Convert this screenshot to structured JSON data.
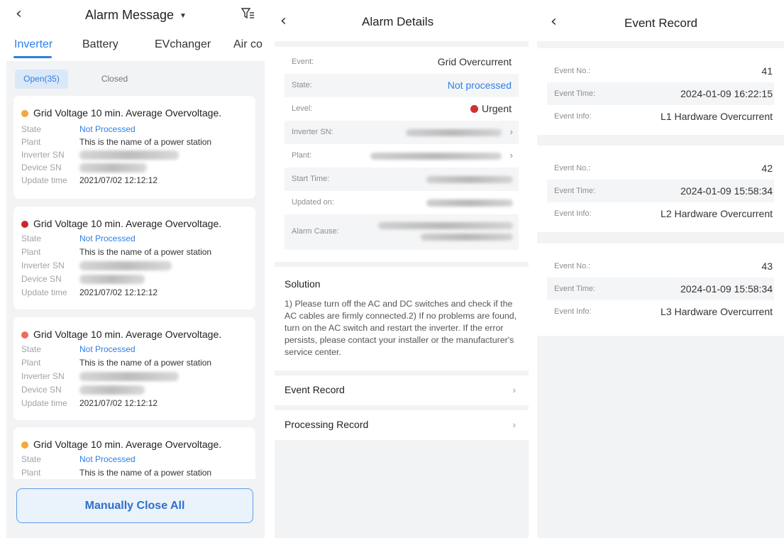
{
  "screen1": {
    "title": "Alarm Message",
    "tabs": [
      "Inverter",
      "Battery",
      "EVchanger",
      "Air co"
    ],
    "chip_open": "Open(35)",
    "chip_closed": "Closed",
    "labels": {
      "state": "State",
      "plant": "Plant",
      "inverter_sn": "Inverter SN",
      "device_sn": "Device SN",
      "update_time": "Update time"
    },
    "cards": [
      {
        "title": "Grid Voltage 10 min. Average Overvoltage.",
        "dot_color": "#f0a93b",
        "state": "Not Processed",
        "plant": "This is the name of a power station",
        "update_time": "2021/07/02 12:12:12"
      },
      {
        "title": "Grid Voltage 10 min. Average Overvoltage.",
        "dot_color": "#c8262b",
        "state": "Not Processed",
        "plant": "This is the name of a power station",
        "update_time": "2021/07/02 12:12:12"
      },
      {
        "title": "Grid Voltage 10 min. Average Overvoltage.",
        "dot_color": "#ee6a5e",
        "state": "Not Processed",
        "plant": "This is the name of a power station",
        "update_time": "2021/07/02 12:12:12"
      },
      {
        "title": "Grid Voltage 10 min. Average Overvoltage.",
        "dot_color": "#f0a93b",
        "state": "Not Processed",
        "plant": "This is the name of a power station"
      }
    ],
    "close_all": "Manually Close All"
  },
  "screen2": {
    "title": "Alarm Details",
    "rows": {
      "event": {
        "label": "Event:",
        "value": "Grid Overcurrent"
      },
      "state": {
        "label": "State:",
        "value": "Not processed"
      },
      "level": {
        "label": "Level:",
        "value": "Urgent"
      },
      "inverter_sn": {
        "label": "Inverter SN:"
      },
      "plant": {
        "label": "Plant:"
      },
      "start_time": {
        "label": "Start Time:"
      },
      "updated_on": {
        "label": "Updated on:"
      },
      "alarm_cause": {
        "label": "Alarm Cause:"
      }
    },
    "solution_title": "Solution",
    "solution_text": "1) Please turn off the AC and DC switches and check if the AC cables are firmly connected.2) If no problems are found, turn on the AC switch and restart the inverter. If the error persists, please contact your installer or the manufacturer's service center.",
    "event_record": "Event Record",
    "processing_record": "Processing Record"
  },
  "screen3": {
    "title": "Event Record",
    "labels": {
      "no": "Event No.:",
      "time": "Event Time:",
      "info": "Event Info:"
    },
    "events": [
      {
        "no": "41",
        "time": "2024-01-09 16:22:15",
        "info": "L1 Hardware Overcurrent"
      },
      {
        "no": "42",
        "time": "2024-01-09 15:58:34",
        "info": "L2 Hardware Overcurrent"
      },
      {
        "no": "43",
        "time": "2024-01-09 15:58:34",
        "info": "L3 Hardware Overcurrent"
      }
    ]
  },
  "colors": {
    "accent": "#2f7fe6",
    "urgent": "#d0312d"
  }
}
